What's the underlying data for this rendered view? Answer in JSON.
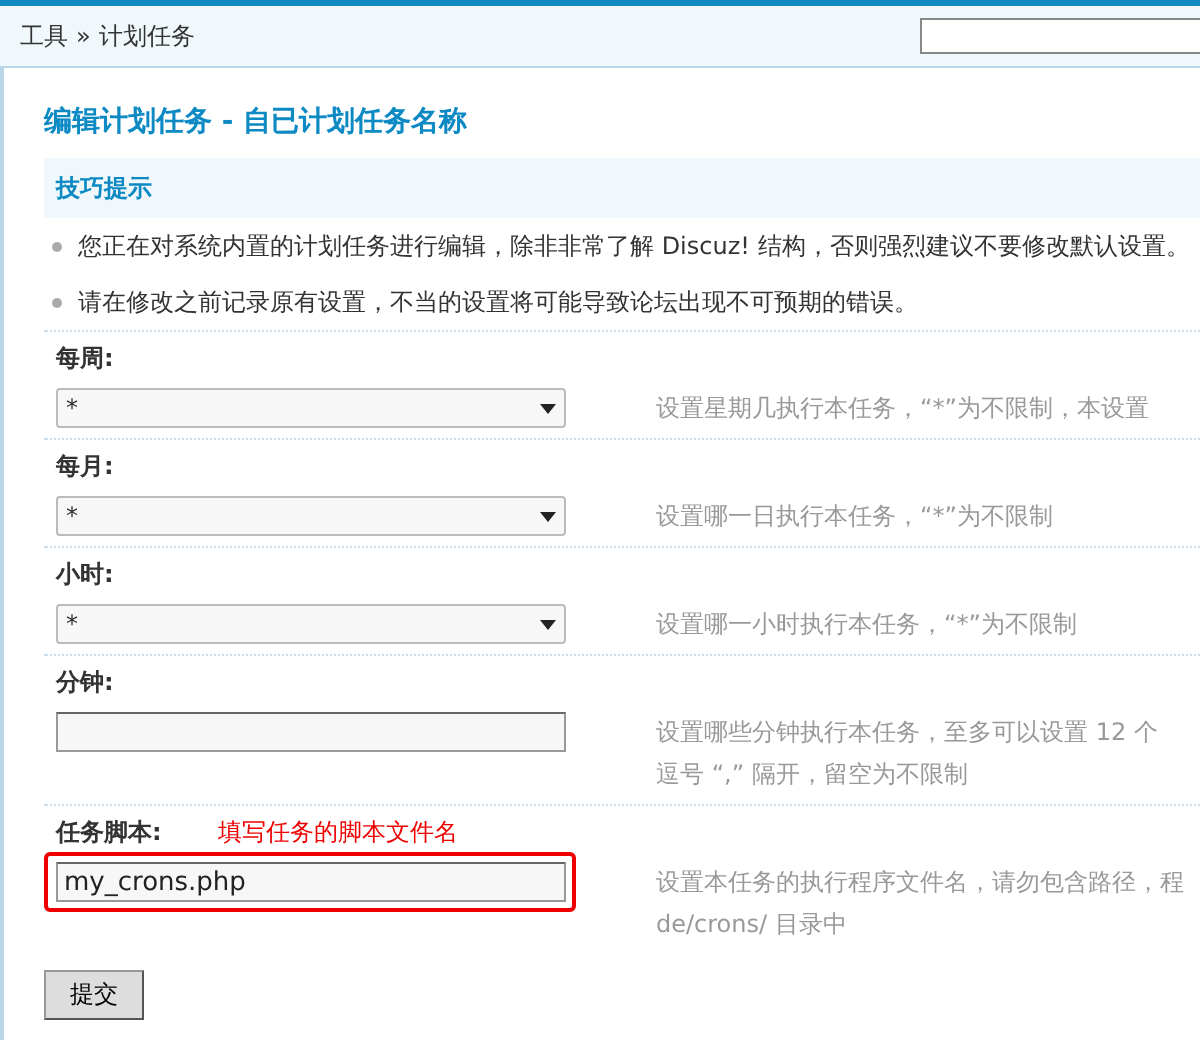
{
  "breadcrumb": {
    "items": [
      "工具",
      "计划任务"
    ],
    "separator": "»"
  },
  "heading": "编辑计划任务 - 自已计划任务名称",
  "tips": {
    "title": "技巧提示",
    "items": [
      "您正在对系统内置的计划任务进行编辑，除非非常了解 Discuz! 结构，否则强烈建议不要修改默认设置。",
      "请在修改之前记录原有设置，不当的设置将可能导致论坛出现不可预期的错误。"
    ]
  },
  "fields": [
    {
      "label": "每周:",
      "kind": "select",
      "value": "*",
      "hint": [
        "设置星期几执行本任务，“*”为不限制，本设置"
      ]
    },
    {
      "label": "每月:",
      "kind": "select",
      "value": "*",
      "hint": [
        "设置哪一日执行本任务，“*”为不限制"
      ]
    },
    {
      "label": "小时:",
      "kind": "select",
      "value": "*",
      "hint": [
        "设置哪一小时执行本任务，“*”为不限制"
      ]
    },
    {
      "label": "分钟:",
      "kind": "text",
      "hint": [
        "设置哪些分钟执行本任务，至多可以设置 12 个",
        "逗号 “,” 隔开，留空为不限制"
      ]
    },
    {
      "label": "任务脚本:",
      "kind": "text",
      "value": "my_crons.php",
      "annotation": "填写任务的脚本文件名",
      "hint": [
        "设置本任务的执行程序文件名，请勿包含路径，程",
        "de/crons/ 目录中"
      ]
    }
  ],
  "submit": "提交"
}
